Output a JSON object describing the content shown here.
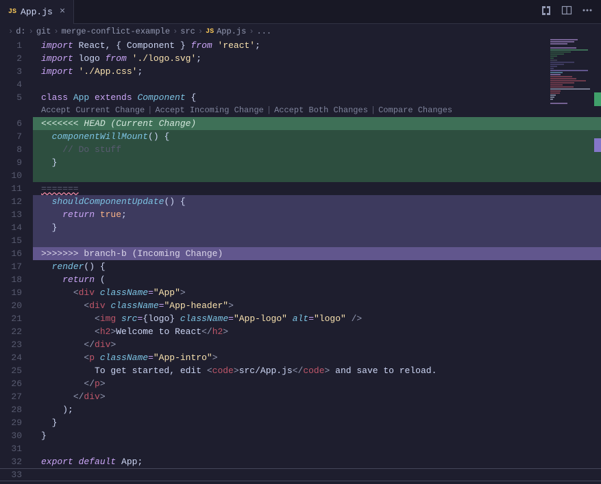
{
  "tab": {
    "icon": "JS",
    "name": "App.js"
  },
  "breadcrumbs": {
    "items": [
      "d:",
      "git",
      "merge-conflict-example",
      "src"
    ],
    "fileIcon": "JS",
    "fileName": "App.js",
    "ellipsis": "..."
  },
  "codelens": {
    "acceptCurrent": "Accept Current Change",
    "acceptIncoming": "Accept Incoming Change",
    "acceptBoth": "Accept Both Changes",
    "compare": "Compare Changes"
  },
  "conflict": {
    "headMarker": "<<<<<<< HEAD (Current Change)",
    "separator": "=======",
    "incomingMarker": ">>>>>>> branch-b (Incoming Change)"
  },
  "code": {
    "l1": {
      "a": "import",
      "b": " React",
      "c": ",",
      "d": " {",
      "e": " Component",
      "f": " }",
      "g": " from ",
      "h": "'react'",
      "i": ";"
    },
    "l2": {
      "a": "import",
      "b": " logo ",
      "c": "from ",
      "d": "'./logo.svg'",
      "e": ";"
    },
    "l3": {
      "a": "import ",
      "b": "'./App.css'",
      "c": ";"
    },
    "l5": {
      "a": "class ",
      "b": "App ",
      "c": "extends ",
      "d": "Component",
      "e": " {"
    },
    "l7": {
      "a": "  ",
      "b": "componentWillMount",
      "c": "()",
      " d": " {"
    },
    "l8": {
      "a": "    ",
      "b": "// Do stuff"
    },
    "l9": {
      "a": "  }"
    },
    "l12": {
      "a": "  ",
      "b": "shouldComponentUpdate",
      "c": "()",
      " d": " {"
    },
    "l13": {
      "a": "    ",
      "b": "return ",
      "c": "true",
      "d": ";"
    },
    "l14": {
      "a": "  }"
    },
    "l17": {
      "a": "  ",
      "b": "render",
      "c": "()",
      " d": " {"
    },
    "l18": {
      "a": "    ",
      "b": "return ",
      "c": "("
    },
    "l19": {
      "a": "      ",
      "b": "<",
      "c": "div ",
      "d": "className",
      "e": "=",
      "f": "\"App\"",
      "g": ">"
    },
    "l20": {
      "a": "        ",
      "b": "<",
      "c": "div ",
      "d": "className",
      "e": "=",
      "f": "\"App-header\"",
      "g": ">"
    },
    "l21": {
      "a": "          ",
      "b": "<",
      "c": "img ",
      "d": "src",
      "e": "=",
      "f": "{",
      "g": "logo",
      "h": "}",
      " i": " ",
      "j": "className",
      "k": "=",
      "l": "\"App-logo\"",
      " m": " ",
      "n": "alt",
      "o": "=",
      "p": "\"logo\"",
      " q": " />"
    },
    "l22": {
      "a": "          ",
      "b": "<",
      "c": "h2",
      "d": ">",
      "e": "Welcome to React",
      "f": "</",
      "g": "h2",
      "h": ">"
    },
    "l23": {
      "a": "        ",
      "b": "</",
      "c": "div",
      "d": ">"
    },
    "l24": {
      "a": "        ",
      "b": "<",
      "c": "p ",
      "d": "className",
      "e": "=",
      "f": "\"App-intro\"",
      "g": ">"
    },
    "l25": {
      "a": "          To get started, edit ",
      "b": "<",
      "c": "code",
      "d": ">",
      "e": "src/App.js",
      "f": "</",
      "g": "code",
      "h": ">",
      "i": " and save to reload."
    },
    "l26": {
      "a": "        ",
      "b": "</",
      "c": "p",
      "d": ">"
    },
    "l27": {
      "a": "      ",
      "b": "</",
      "c": "div",
      "d": ">"
    },
    "l28": {
      "a": "    )",
      "b": ";"
    },
    "l29": {
      "a": "  }"
    },
    "l30": {
      "a": "}"
    },
    "l32": {
      "a": "export ",
      "b": "default ",
      "c": "App",
      "d": ";"
    }
  },
  "lineNumbers": [
    "1",
    "2",
    "3",
    "4",
    "5",
    "6",
    "7",
    "8",
    "9",
    "10",
    "11",
    "12",
    "13",
    "14",
    "15",
    "16",
    "17",
    "18",
    "19",
    "20",
    "21",
    "22",
    "23",
    "24",
    "25",
    "26",
    "27",
    "28",
    "29",
    "30",
    "31",
    "32",
    "33"
  ]
}
